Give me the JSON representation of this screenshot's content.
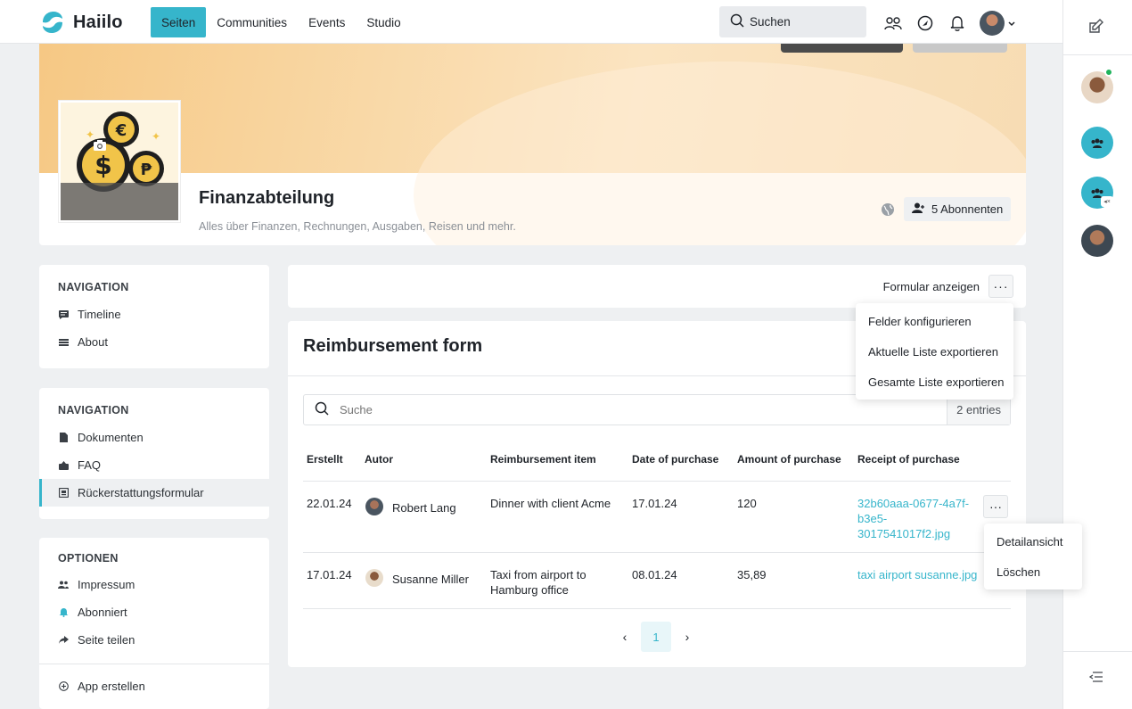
{
  "app": {
    "name": "Haiilo"
  },
  "nav": {
    "items": [
      "Seiten",
      "Communities",
      "Events",
      "Studio"
    ],
    "active": "Seiten"
  },
  "topbar": {
    "search_label": "Suchen"
  },
  "colors": {
    "accent": "#36b5cb",
    "text": "#1f2329",
    "muted": "#8a8f96",
    "background": "#eef0f2"
  },
  "page": {
    "title": "Finanzabteilung",
    "description": "Alles über Finanzen, Rechnungen, Ausgaben, Reisen und mehr.",
    "subscribers": "5 Abonnenten"
  },
  "sidebar": {
    "nav1": {
      "heading": "NAVIGATION",
      "items": [
        {
          "label": "Timeline",
          "icon": "comment-icon"
        },
        {
          "label": "About",
          "icon": "list-icon"
        }
      ]
    },
    "nav2": {
      "heading": "NAVIGATION",
      "items": [
        {
          "label": "Dokumenten",
          "icon": "document-icon"
        },
        {
          "label": "FAQ",
          "icon": "faq-icon"
        },
        {
          "label": "Rückerstattungsformular",
          "icon": "form-icon",
          "active": true
        }
      ]
    },
    "options": {
      "heading": "OPTIONEN",
      "items": [
        {
          "label": "Impressum",
          "icon": "people-icon"
        },
        {
          "label": "Abonniert",
          "icon": "bell-icon"
        },
        {
          "label": "Seite teilen",
          "icon": "share-icon"
        }
      ],
      "create_app": "App erstellen"
    }
  },
  "toolbar": {
    "form_link": "Formular anzeigen"
  },
  "toolbar_menu": [
    "Felder konfigurieren",
    "Aktuelle Liste exportieren",
    "Gesamte Liste exportieren"
  ],
  "form": {
    "title": "Reimbursement form",
    "search_placeholder": "Suche",
    "entries": "2 entries",
    "columns": [
      "Erstellt",
      "Autor",
      "Reimbursement item",
      "Date of purchase",
      "Amount of purchase",
      "Receipt of purchase"
    ],
    "rows": [
      {
        "created": "22.01.24",
        "author": "Robert Lang",
        "item": "Dinner with client Acme",
        "date": "17.01.24",
        "amount": "120",
        "receipt": [
          "32b60aaa-0677-4a7f-",
          "b3e5-",
          "3017541017f2.jpg"
        ]
      },
      {
        "created": "17.01.24",
        "author": "Susanne Miller",
        "item": [
          "Taxi from airport to",
          "Hamburg office"
        ],
        "date": "08.01.24",
        "amount": "35,89",
        "receipt": [
          "taxi airport susanne.jpg"
        ]
      }
    ],
    "row_menu": [
      "Detailansicht",
      "Löschen"
    ],
    "pagination": {
      "current": "1"
    }
  }
}
